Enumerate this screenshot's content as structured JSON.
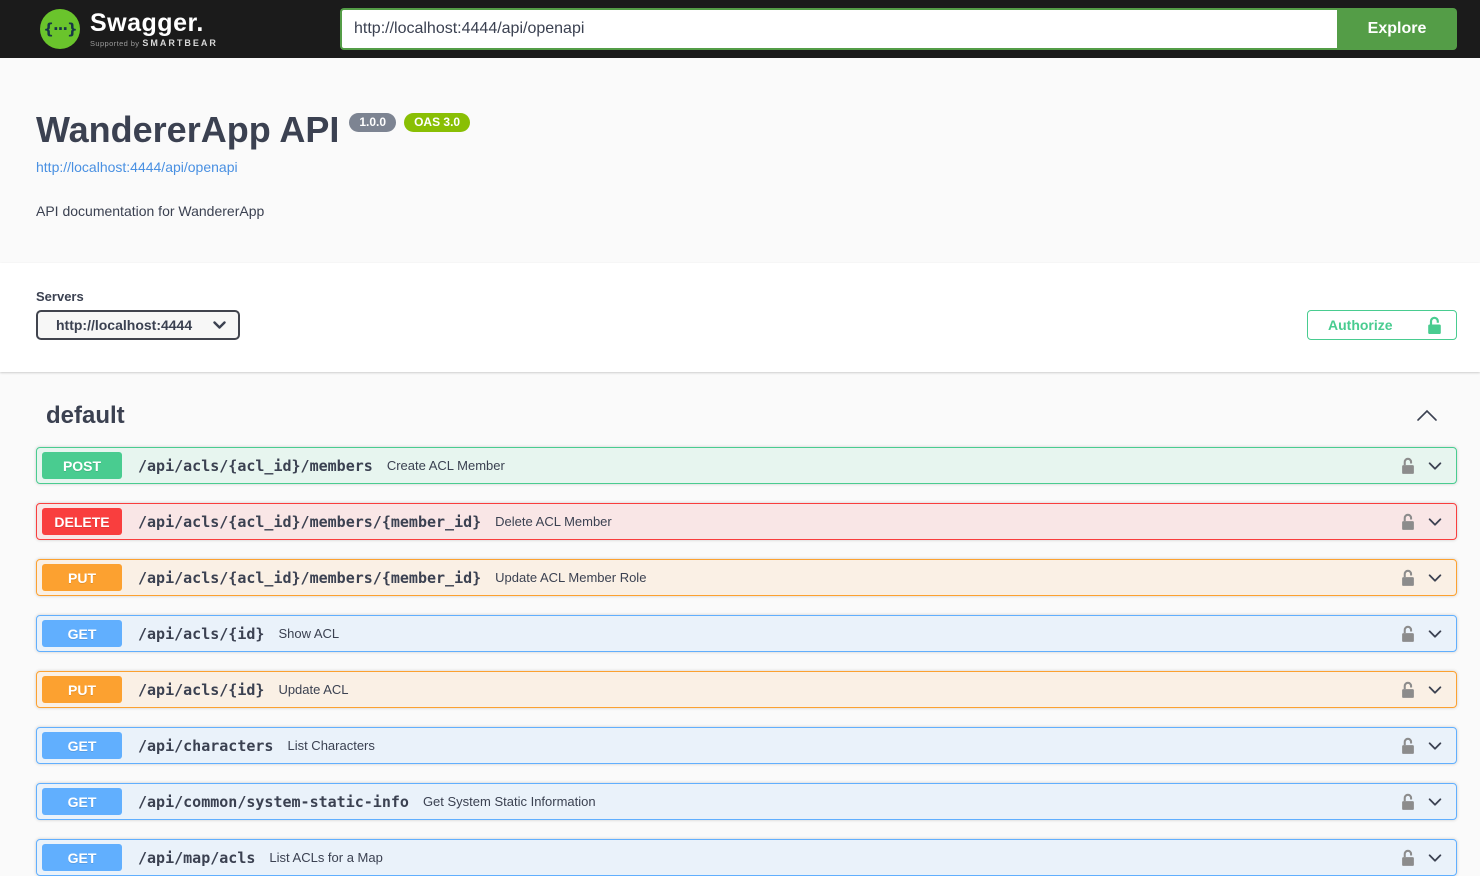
{
  "topbar": {
    "logo_glyph": "{···}",
    "brand": "Swagger.",
    "tagline_prefix": "Supported by",
    "tagline_brand": "SMARTBEAR",
    "url_input": "http://localhost:4444/api/openapi",
    "explore_button": "Explore"
  },
  "info": {
    "title": "WandererApp API",
    "version_badge": "1.0.0",
    "oas_badge": "OAS 3.0",
    "spec_url": "http://localhost:4444/api/openapi",
    "description": "API documentation for WandererApp"
  },
  "servers": {
    "label": "Servers",
    "selected": "http://localhost:4444"
  },
  "auth": {
    "authorize_label": "Authorize"
  },
  "section": {
    "title": "default"
  },
  "operations": [
    {
      "method": "POST",
      "path": "/api/acls/{acl_id}/members",
      "summary": "Create ACL Member"
    },
    {
      "method": "DELETE",
      "path": "/api/acls/{acl_id}/members/{member_id}",
      "summary": "Delete ACL Member"
    },
    {
      "method": "PUT",
      "path": "/api/acls/{acl_id}/members/{member_id}",
      "summary": "Update ACL Member Role"
    },
    {
      "method": "GET",
      "path": "/api/acls/{id}",
      "summary": "Show ACL"
    },
    {
      "method": "PUT",
      "path": "/api/acls/{id}",
      "summary": "Update ACL"
    },
    {
      "method": "GET",
      "path": "/api/characters",
      "summary": "List Characters"
    },
    {
      "method": "GET",
      "path": "/api/common/system-static-info",
      "summary": "Get System Static Information"
    },
    {
      "method": "GET",
      "path": "/api/map/acls",
      "summary": "List ACLs for a Map"
    }
  ],
  "colors": {
    "topbar_bg": "#1b1b1b",
    "logo_green": "#6ac42c",
    "explore_green": "#549d47",
    "authorize_green": "#49cc90",
    "link_blue": "#4990e2",
    "version_badge_gray": "#7d8492",
    "oas_badge_green": "#89bf04",
    "get": "#61affe",
    "post": "#49cc90",
    "put": "#fca130",
    "delete": "#f93e3e"
  }
}
